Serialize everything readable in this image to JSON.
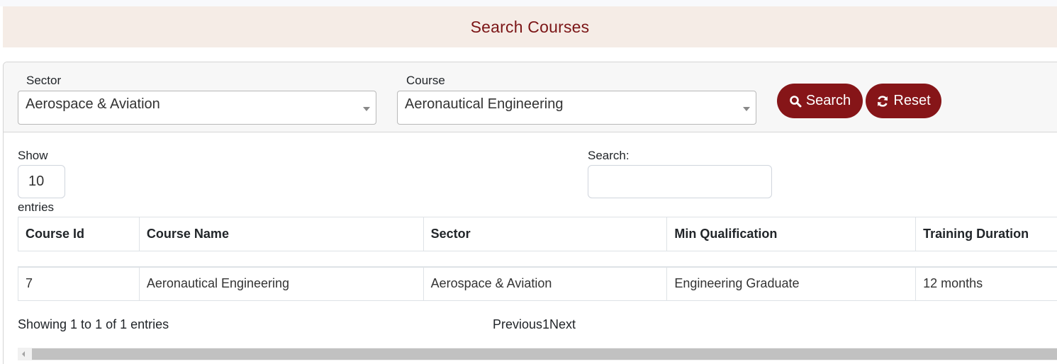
{
  "page": {
    "title": "Search Courses"
  },
  "filters": {
    "sector_label": "Sector",
    "sector_value": "Aerospace & Aviation",
    "course_label": "Course",
    "course_value": "Aeronautical Engineering",
    "search_button": "Search",
    "reset_button": "Reset"
  },
  "table_controls": {
    "show_label": "Show",
    "page_length": "10",
    "entries_label": "entries",
    "search_label": "Search:",
    "search_value": ""
  },
  "table": {
    "columns": [
      "Course Id",
      "Course Name",
      "Sector",
      "Min Qualification",
      "Training Duration"
    ],
    "rows": [
      [
        "7",
        "Aeronautical Engineering",
        "Aerospace & Aviation",
        "Engineering Graduate",
        "12 months"
      ]
    ]
  },
  "footer": {
    "info": "Showing 1 to 1 of 1 entries",
    "previous": "Previous",
    "page": "1",
    "next": "Next"
  },
  "colors": {
    "brand": "#861518",
    "title_text": "#7b1516",
    "title_bg": "#f5ece6"
  }
}
